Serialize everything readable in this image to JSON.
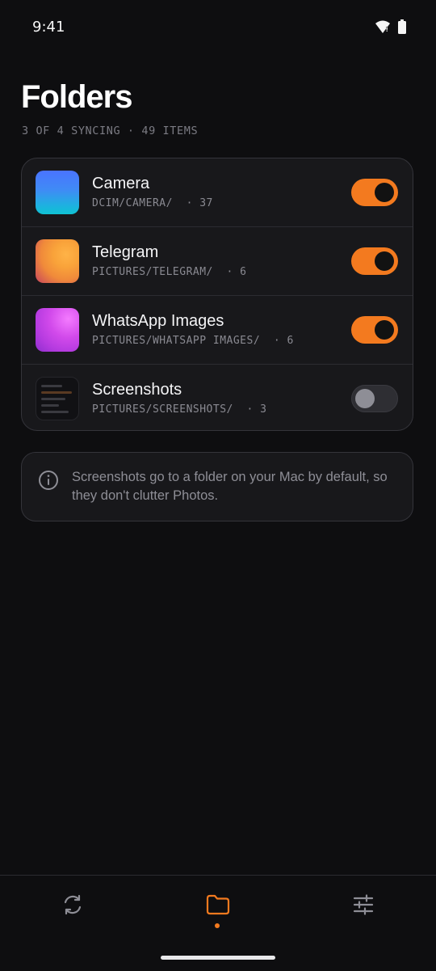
{
  "status_bar": {
    "time": "9:41",
    "icons": [
      "wifi-icon",
      "battery-icon"
    ]
  },
  "header": {
    "title": "Folders",
    "subtitle": "3 OF 4 SYNCING · 49 ITEMS"
  },
  "folders": [
    {
      "name": "Camera",
      "path": "DCIM/CAMERA/  · 37",
      "enabled": true,
      "thumbnail": "blue-gradient"
    },
    {
      "name": "Telegram",
      "path": "PICTURES/TELEGRAM/  · 6",
      "enabled": true,
      "thumbnail": "orange-gradient"
    },
    {
      "name": "WhatsApp Images",
      "path": "PICTURES/WHATSAPP IMAGES/  · 6",
      "enabled": true,
      "thumbnail": "purple-gradient"
    },
    {
      "name": "Screenshots",
      "path": "PICTURES/SCREENSHOTS/  · 3",
      "enabled": false,
      "thumbnail": "screenshot-preview"
    }
  ],
  "info": {
    "icon": "info-icon",
    "text": "Screenshots go to a folder on your Mac by default, so they don't clutter Photos."
  },
  "tab_bar": {
    "tabs": [
      {
        "icon": "sync-icon",
        "active": false
      },
      {
        "icon": "folder-icon",
        "active": true
      },
      {
        "icon": "sliders-icon",
        "active": false
      }
    ]
  },
  "colors": {
    "background": "#0e0e10",
    "card": "#18181b",
    "accent": "#f37a1f",
    "muted_text": "#8e8e96"
  }
}
